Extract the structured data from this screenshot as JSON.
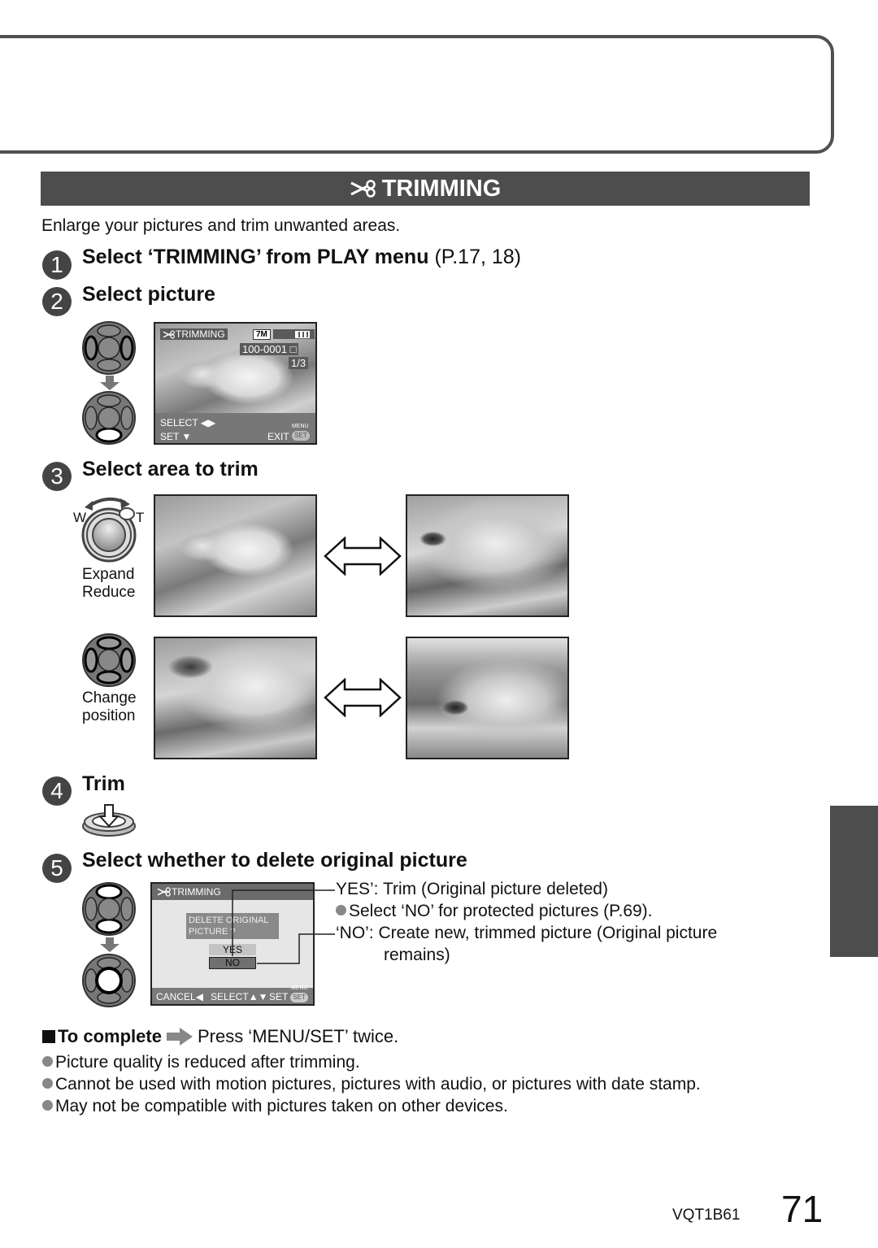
{
  "section": {
    "icon": "scissors-icon",
    "title": "TRIMMING"
  },
  "intro": "Enlarge your pictures and trim unwanted areas.",
  "steps": [
    {
      "num": "1",
      "title": "Select ‘TRIMMING’ from PLAY menu",
      "ref": "(P.17, 18)"
    },
    {
      "num": "2",
      "title": "Select picture",
      "ref": ""
    },
    {
      "num": "3",
      "title": "Select area to trim",
      "ref": ""
    },
    {
      "num": "4",
      "title": "Trim",
      "ref": ""
    },
    {
      "num": "5",
      "title": "Select whether to delete original picture",
      "ref": ""
    }
  ],
  "screen_select": {
    "mode_label": "TRIMMING",
    "quality_badge": "7M",
    "file_number": "100-0001",
    "counter": "1/3",
    "hint_select": "SELECT",
    "hint_set": "SET",
    "hint_exit": "EXIT",
    "menu_small": "MENU",
    "set_small": "SET"
  },
  "zoom_lever": {
    "wide_label": "W",
    "tele_label": "T",
    "caption_line1": "Expand",
    "caption_line2": "Reduce"
  },
  "cursor_caption": {
    "line1": "Change",
    "line2": "position"
  },
  "screen_delete": {
    "mode_label": "TRIMMING",
    "question_line1": "DELETE ORIGINAL",
    "question_line2": "PICTURE ?",
    "yes_label": "YES",
    "no_label": "NO",
    "hint_cancel": "CANCEL",
    "hint_select": "SELECT",
    "hint_set": "SET",
    "menu_small": "MENU",
    "set_small": "SET"
  },
  "delete_options": {
    "yes_text": "YES’: Trim (Original picture deleted)",
    "yes_note": "Select ‘NO’ for protected pictures (P.69).",
    "no_text": "‘NO’: Create new, trimmed picture (Original picture",
    "no_text_cont": "remains)"
  },
  "to_complete": {
    "label": "To complete",
    "instruction": "Press ‘MENU/SET’ twice."
  },
  "notes": [
    "Picture quality is reduced after trimming.",
    "Cannot be used with motion pictures, pictures with audio, or pictures with date stamp.",
    "May not be compatible with pictures taken on other devices."
  ],
  "footer": {
    "doc_code": "VQT1B61",
    "page_number": "71"
  }
}
